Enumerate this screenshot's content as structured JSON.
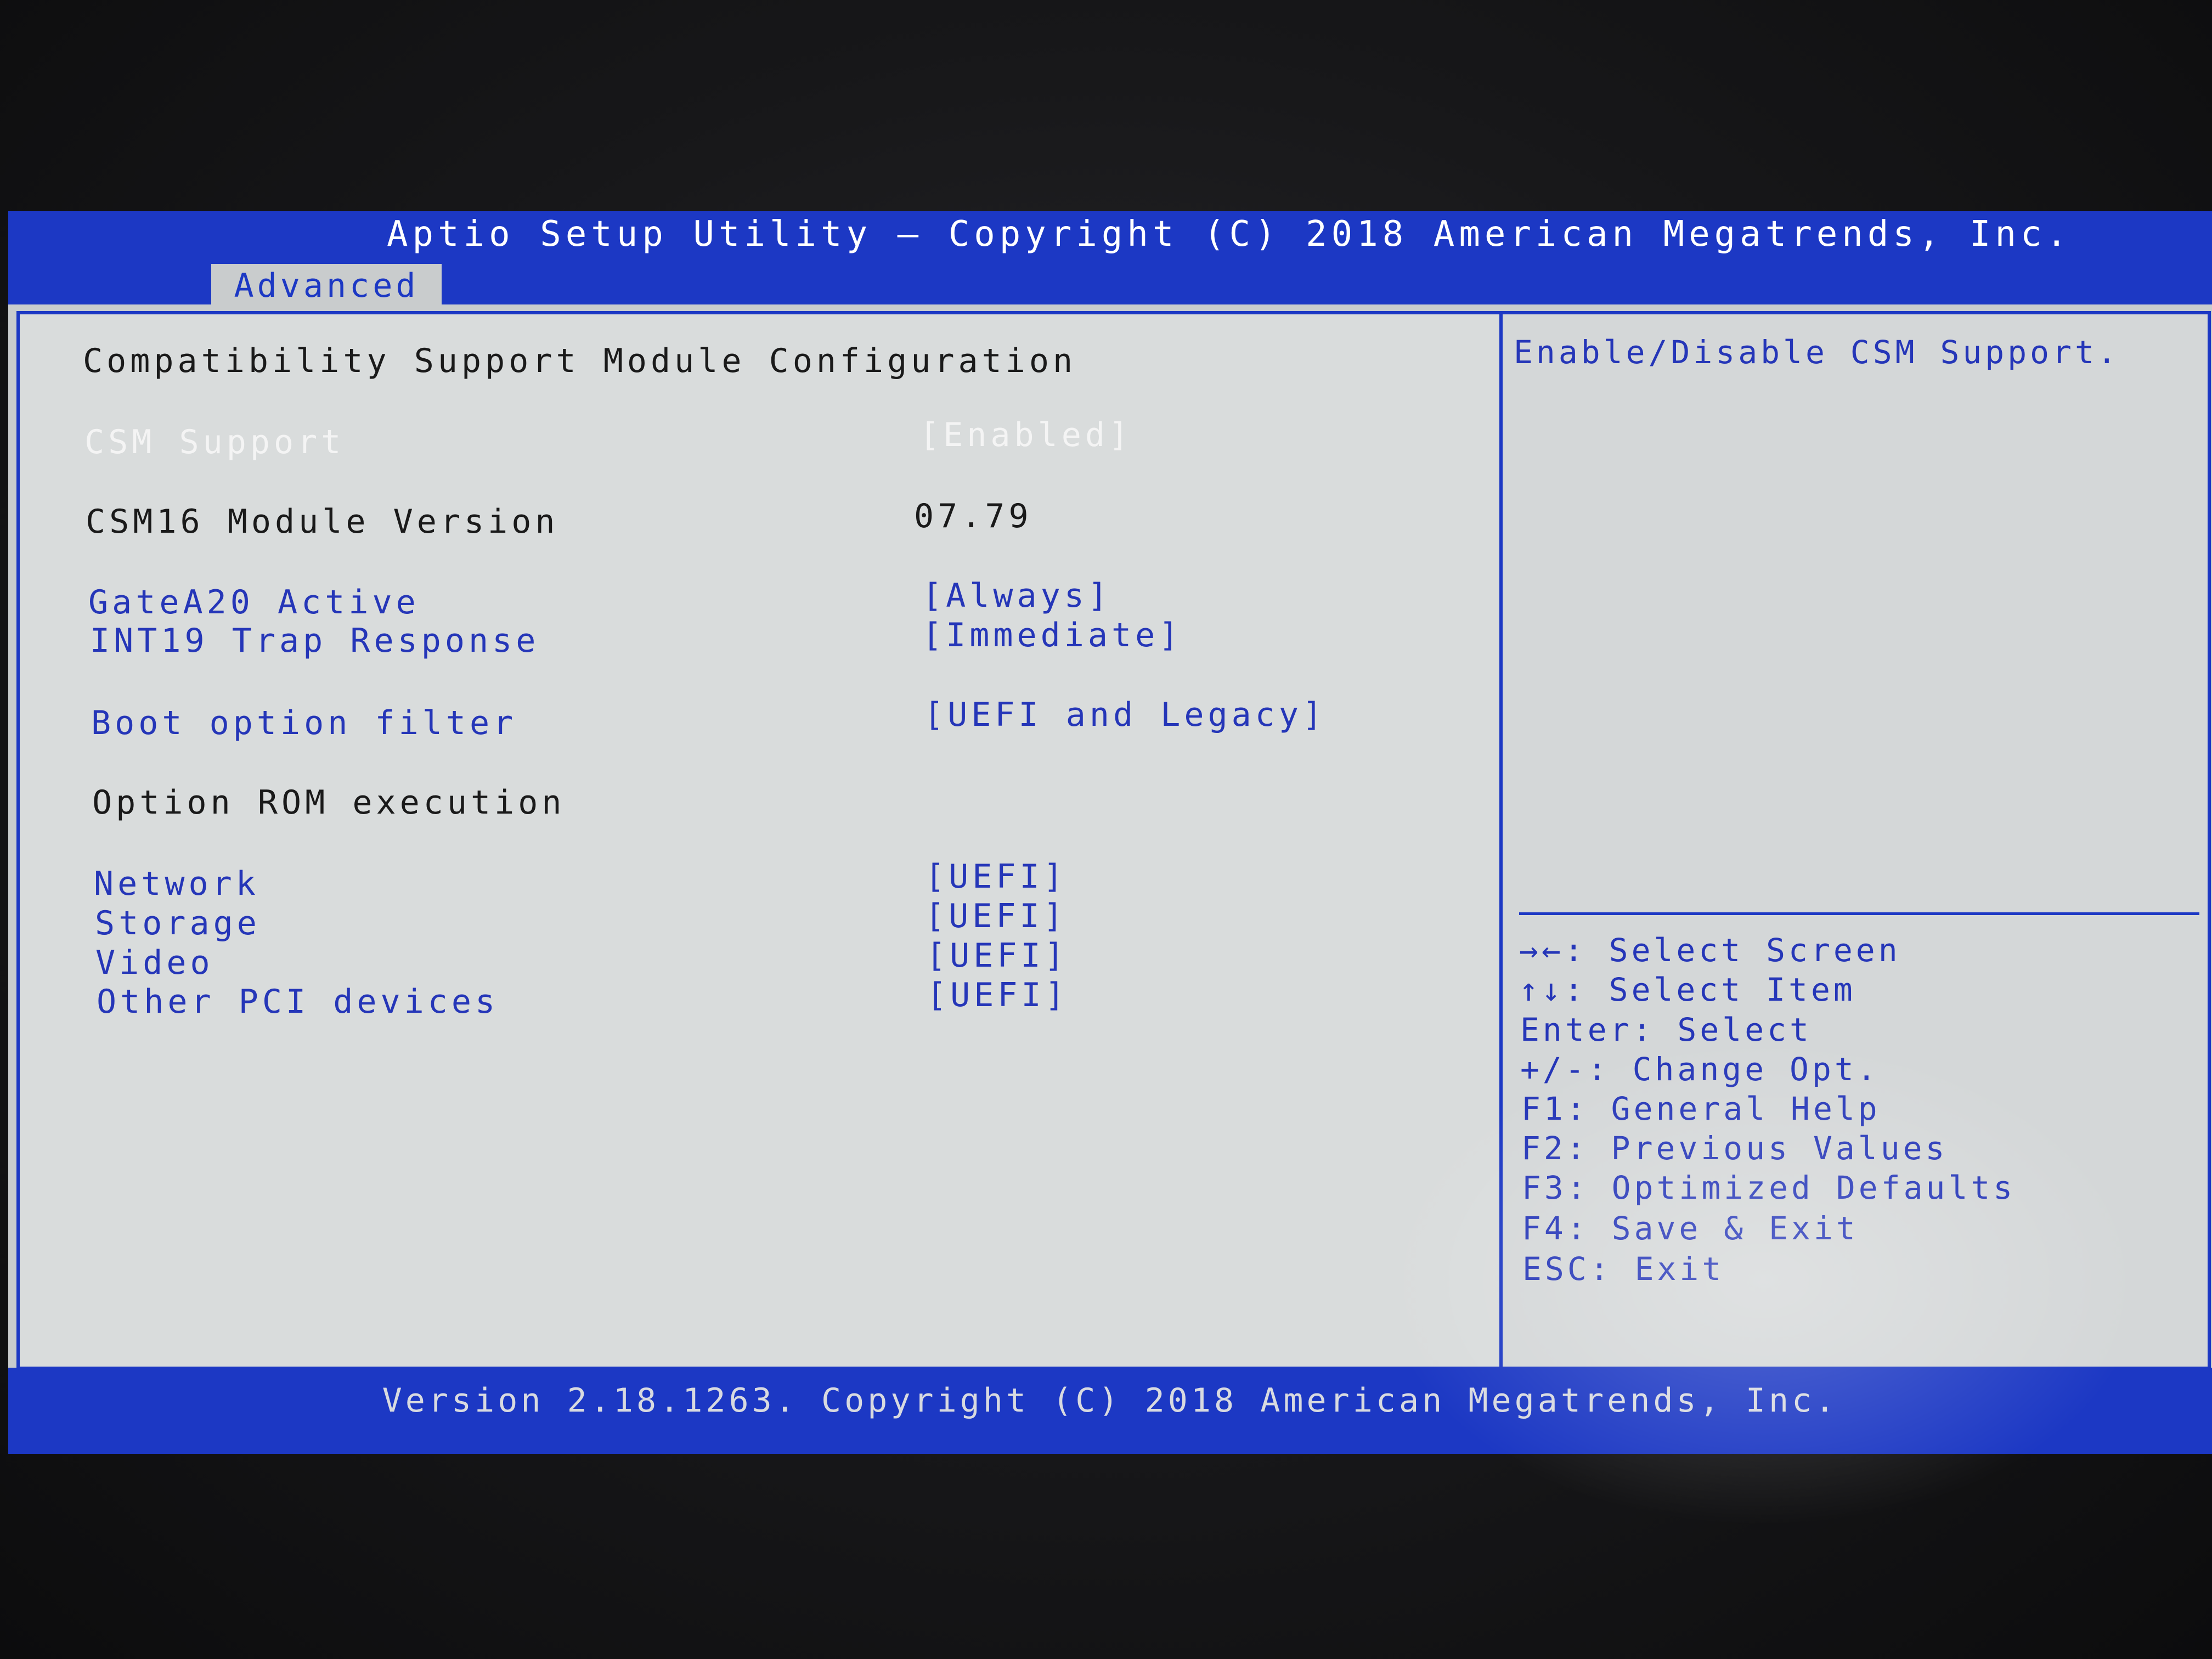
{
  "header": {
    "title": "Aptio Setup Utility – Copyright (C) 2018 American Megatrends, Inc.",
    "active_tab": "Advanced"
  },
  "main": {
    "section_title": "Compatibility Support Module Configuration",
    "items": [
      {
        "label": "CSM Support",
        "value": "[Enabled]"
      },
      {
        "label": "CSM16 Module Version",
        "value": "07.79"
      },
      {
        "label": "GateA20 Active",
        "value": "[Always]"
      },
      {
        "label": "INT19 Trap Response",
        "value": "[Immediate]"
      },
      {
        "label": "Boot option filter",
        "value": "[UEFI and Legacy]"
      },
      {
        "label": "Option ROM execution",
        "value": ""
      },
      {
        "label": "Network",
        "value": "[UEFI]"
      },
      {
        "label": "Storage",
        "value": "[UEFI]"
      },
      {
        "label": "Video",
        "value": "[UEFI]"
      },
      {
        "label": "Other PCI devices",
        "value": "[UEFI]"
      }
    ]
  },
  "help": {
    "description": "Enable/Disable CSM Support.",
    "keys": [
      "→←: Select Screen",
      "↑↓: Select Item",
      "Enter: Select",
      "+/-: Change Opt.",
      "F1: General Help",
      "F2: Previous Values",
      "F3: Optimized Defaults",
      "F4: Save & Exit",
      "ESC: Exit"
    ]
  },
  "footer": {
    "text": "Version 2.18.1263. Copyright (C) 2018 American Megatrends, Inc."
  }
}
